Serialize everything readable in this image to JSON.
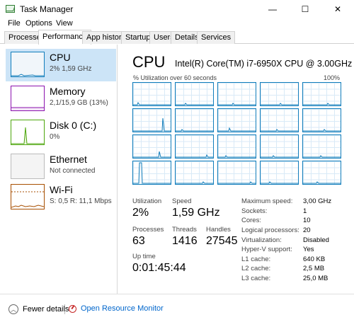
{
  "window": {
    "title": "Task Manager",
    "minimize": "—",
    "maximize": "☐",
    "close": "✕"
  },
  "menu": [
    "File",
    "Options",
    "View"
  ],
  "tabs": [
    "Processes",
    "Performance",
    "App history",
    "Startup",
    "Users",
    "Details",
    "Services"
  ],
  "active_tab": "Performance",
  "sidebar": [
    {
      "name": "CPU",
      "sub": "2% 1,59 GHz",
      "color": "#117dbb",
      "icon": "cpu-graph"
    },
    {
      "name": "Memory",
      "sub": "2,1/15,9 GB (13%)",
      "color": "#8b12ae",
      "icon": "memory-graph"
    },
    {
      "name": "Disk 0 (C:)",
      "sub": "0%",
      "color": "#4da60c",
      "icon": "disk-graph"
    },
    {
      "name": "Ethernet",
      "sub": "Not connected",
      "color": "#bbbbbb",
      "icon": "ethernet-graph"
    },
    {
      "name": "Wi-Fi",
      "sub": "S: 0,5 R: 11,1 Mbps",
      "color": "#a74f01",
      "icon": "wifi-graph"
    }
  ],
  "cpu": {
    "title": "CPU",
    "model": "Intel(R) Core(TM) i7-6950X CPU @ 3.00GHz",
    "util_label": "% Utilization over 60 seconds",
    "util_max": "100%",
    "core_count": 20
  },
  "stats": {
    "utilization_label": "Utilization",
    "utilization": "2%",
    "speed_label": "Speed",
    "speed": "1,59 GHz",
    "processes_label": "Processes",
    "processes": "63",
    "threads_label": "Threads",
    "threads": "1416",
    "handles_label": "Handles",
    "handles": "27545",
    "uptime_label": "Up time",
    "uptime": "0:01:45:44"
  },
  "specs": [
    {
      "label": "Maximum speed:",
      "value": "3,00 GHz"
    },
    {
      "label": "Sockets:",
      "value": "1"
    },
    {
      "label": "Cores:",
      "value": "10"
    },
    {
      "label": "Logical processors:",
      "value": "20"
    },
    {
      "label": "Virtualization:",
      "value": "Disabled"
    },
    {
      "label": "Hyper-V support:",
      "value": "Yes"
    },
    {
      "label": "L1 cache:",
      "value": "640 KB"
    },
    {
      "label": "L2 cache:",
      "value": "2,5 MB"
    },
    {
      "label": "L3 cache:",
      "value": "25,0 MB"
    }
  ],
  "footer": {
    "fewer_details": "Fewer details",
    "open_resource_monitor": "Open Resource Monitor"
  }
}
